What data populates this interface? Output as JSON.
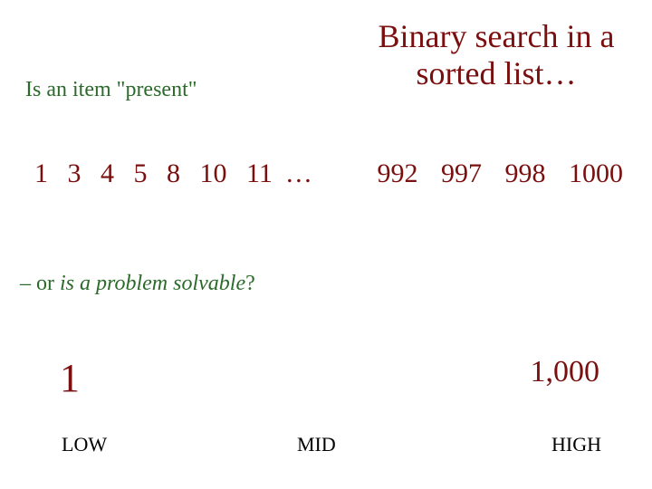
{
  "title": "Binary search in a sorted list…",
  "intro": "Is an item \"present\"",
  "sequence_left": [
    "1",
    "3",
    "4",
    "5",
    "8",
    "10",
    "11"
  ],
  "sequence_ellipsis": "…",
  "sequence_right": [
    "992",
    "997",
    "998",
    "1000"
  ],
  "subline_prefix": "– or ",
  "subline_italic": "is a problem solvable",
  "subline_suffix": "?",
  "range": {
    "low_value": "1",
    "high_value": "1,000",
    "low_label": "LOW",
    "mid_label": "MID",
    "high_label": "HIGH"
  }
}
